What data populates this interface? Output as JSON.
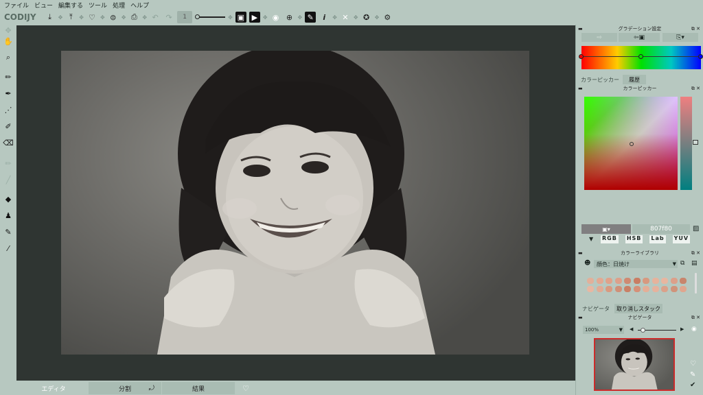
{
  "menu": [
    "ファイル",
    "ビュー",
    "編集する",
    "ツール",
    "処理",
    "ヘルプ"
  ],
  "toolbar": {
    "logo": "CODIJY",
    "brush_size": "1"
  },
  "bottom_tabs": {
    "editor": "エディタ",
    "split": "分割",
    "result": "結果"
  },
  "gradient_panel": {
    "title": "グラデーション設定",
    "colors": [
      "#ff0000",
      "#00e000",
      "#0000ff"
    ]
  },
  "color_picker_panel": {
    "tabs": [
      "カラーピッカー",
      "履歴"
    ],
    "title": "カラーピッカー",
    "hex_value": "807f80",
    "modes": [
      "RGB",
      "HSB",
      "Lab",
      "YUV"
    ]
  },
  "color_library_panel": {
    "title": "カラーライブラリ",
    "preset": "顔色：日焼け",
    "swatches": [
      "#e2b09a",
      "#e3a992",
      "#e0a28a",
      "#dda08a",
      "#cf8a72",
      "#c97d63",
      "#d7997f",
      "#e6b39c",
      "#e8b6a0",
      "#dca08a",
      "#c8856c",
      "#e8b7a2",
      "#e1ab95",
      "#d99a80",
      "#d09078",
      "#c98066",
      "#d59078",
      "#e4ae97",
      "#e6b29d",
      "#dba18a",
      "#d0937a",
      "#e0a68e"
    ]
  },
  "navigator_panel": {
    "tabs": [
      "ナビゲータ",
      "取り消しスタック"
    ],
    "title": "ナビゲータ",
    "zoom": "100%"
  }
}
